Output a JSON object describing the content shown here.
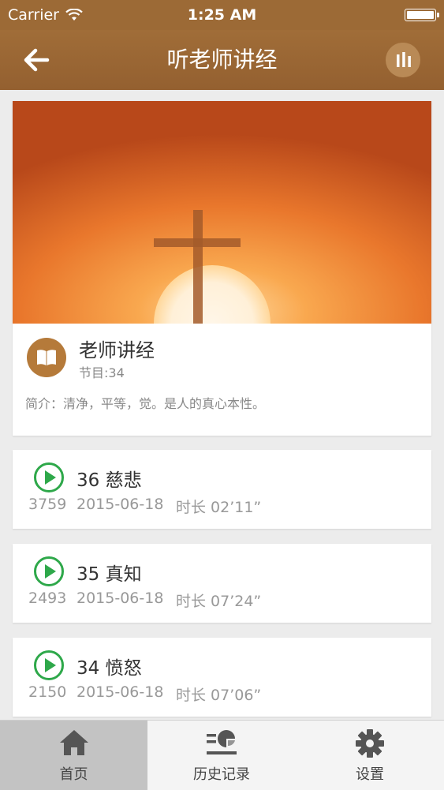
{
  "status_bar": {
    "carrier": "Carrier",
    "time": "1:25 AM"
  },
  "nav": {
    "title": "听老师讲经",
    "back_icon": "arrow-left-icon",
    "player_icon": "equalizer-icon"
  },
  "album": {
    "title": "老师讲经",
    "count": "节目:34",
    "description": "简介：清净，平等，觉。是人的真心本性。",
    "icon": "book-icon"
  },
  "tracks": [
    {
      "title": "36 慈悲",
      "plays": "3759",
      "date": "2015-06-18",
      "duration": "时长 02’11”"
    },
    {
      "title": "35 真知",
      "plays": "2493",
      "date": "2015-06-18",
      "duration": "时长 07’24”"
    },
    {
      "title": "34 愤怒",
      "plays": "2150",
      "date": "2015-06-18",
      "duration": "时长 07’06”"
    }
  ],
  "tabs": [
    {
      "label": "首页",
      "icon": "home-icon",
      "active": true
    },
    {
      "label": "历史记录",
      "icon": "history-icon",
      "active": false
    },
    {
      "label": "设置",
      "icon": "gear-icon",
      "active": false
    }
  ],
  "colors": {
    "brand_brown": "#9c6a36",
    "play_green": "#2ea84a",
    "active_tab": "#c3c3c3"
  }
}
